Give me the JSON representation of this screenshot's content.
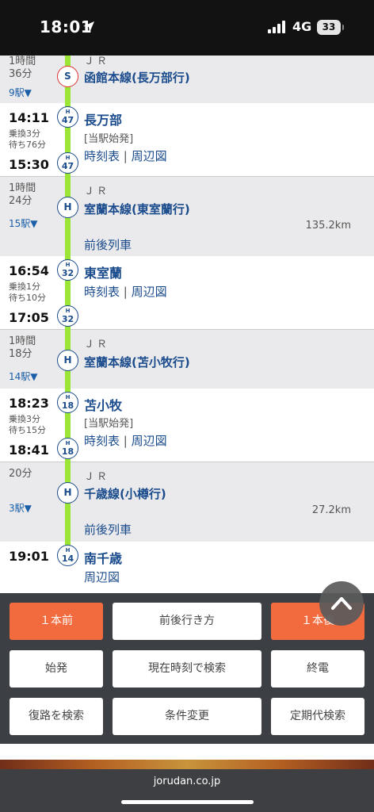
{
  "status_bar": {
    "time": "18:01",
    "network": "4G",
    "battery": "33"
  },
  "segments": {
    "s1": {
      "duration": "1時間\n36分",
      "stops": "9駅▼",
      "operator": "ＪＲ",
      "badge": "S",
      "line": "函館本線(長万部行)"
    },
    "st1": {
      "arr": "14:11",
      "xfer": "乗換3分\n待ち76分",
      "dep": "15:30",
      "badge_l": "H",
      "badge_n": "47",
      "name": "長万部",
      "note": "[当駅始発]",
      "timetable": "時刻表",
      "sep": "|",
      "map": "周辺図"
    },
    "s2": {
      "duration": "1時間\n24分",
      "stops": "15駅▼",
      "operator": "ＪＲ",
      "badge": "H",
      "line": "室蘭本線(東室蘭行)",
      "distance": "135.2km",
      "prev_next": "前後列車"
    },
    "st2": {
      "arr": "16:54",
      "xfer": "乗換1分\n待ち10分",
      "dep": "17:05",
      "badge_l": "H",
      "badge_n": "32",
      "name": "東室蘭",
      "timetable": "時刻表",
      "sep": "|",
      "map": "周辺図"
    },
    "s3": {
      "duration": "1時間\n18分",
      "stops": "14駅▼",
      "operator": "ＪＲ",
      "badge": "H",
      "line": "室蘭本線(苫小牧行)"
    },
    "st3": {
      "arr": "18:23",
      "xfer": "乗換3分\n待ち15分",
      "dep": "18:41",
      "badge_l": "H",
      "badge_n": "18",
      "name": "苫小牧",
      "note": "[当駅始発]",
      "timetable": "時刻表",
      "sep": "|",
      "map": "周辺図"
    },
    "s4": {
      "duration": "20分",
      "stops": "3駅▼",
      "operator": "ＪＲ",
      "badge": "H",
      "line": "千歳線(小樽行)",
      "distance": "27.2km",
      "prev_next": "前後列車"
    },
    "st4": {
      "arr": "19:01",
      "badge_l": "H",
      "badge_n": "14",
      "name": "南千歳",
      "map": "周辺図"
    }
  },
  "buttons": {
    "prev": "１本前",
    "around": "前後行き方",
    "next": "１本後",
    "first": "始発",
    "now": "現在時刻で検索",
    "last": "終電",
    "return": "復路を検索",
    "conditions": "条件変更",
    "pass": "定期代検索"
  },
  "footer": {
    "domain": "jorudan.co.jp"
  },
  "colors": {
    "accent_orange": "#f26b3e",
    "route_green": "#9be536",
    "link_blue": "#1a4b8c",
    "panel": "#3c3f44"
  }
}
